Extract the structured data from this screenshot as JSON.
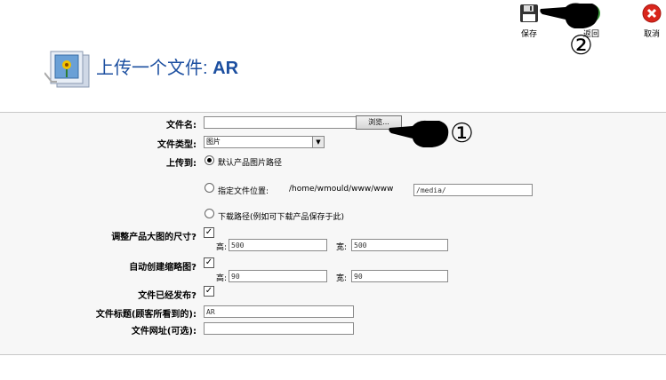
{
  "toolbar": {
    "save_label": "保存",
    "back_label": "返回",
    "cancel_label": "取消"
  },
  "page": {
    "title_prefix": "上传一个文件:",
    "title_name": "AR"
  },
  "form": {
    "filename_label": "文件名:",
    "filename_value": "",
    "browse_label": "浏览...",
    "filetype_label": "文件类型:",
    "filetype_value": "图片",
    "upload_to_label": "上传到:",
    "opt_default_label": "默认产品图片路径",
    "opt_custom_label": "指定文件位置:",
    "custom_path_static": "/home/wmould/www/www",
    "custom_path_value": "/media/",
    "opt_download_label": "下载路径(例如可下载产品保存于此)",
    "resize_label": "调整产品大图的尺寸?",
    "resize_checked": "✓",
    "resize_height_label": "高:",
    "resize_height_value": "500",
    "resize_width_label": "宽:",
    "resize_width_value": "500",
    "thumb_label": "自动创建缩略图?",
    "thumb_checked": "✓",
    "thumb_height_label": "高:",
    "thumb_height_value": "90",
    "thumb_width_label": "宽:",
    "thumb_width_value": "90",
    "published_label": "文件已经发布?",
    "published_checked": "✓",
    "file_title_label": "文件标题(顾客所看到的):",
    "file_title_value": "AR",
    "file_url_label": "文件网址(可选):",
    "file_url_value": ""
  },
  "annotations": {
    "step1": "①",
    "step2": "②"
  },
  "colors": {
    "title": "#1c4fa0",
    "cancel_red": "#d9261c",
    "back_green": "#3a9a3a",
    "panel_bg": "#f7f7f7"
  }
}
